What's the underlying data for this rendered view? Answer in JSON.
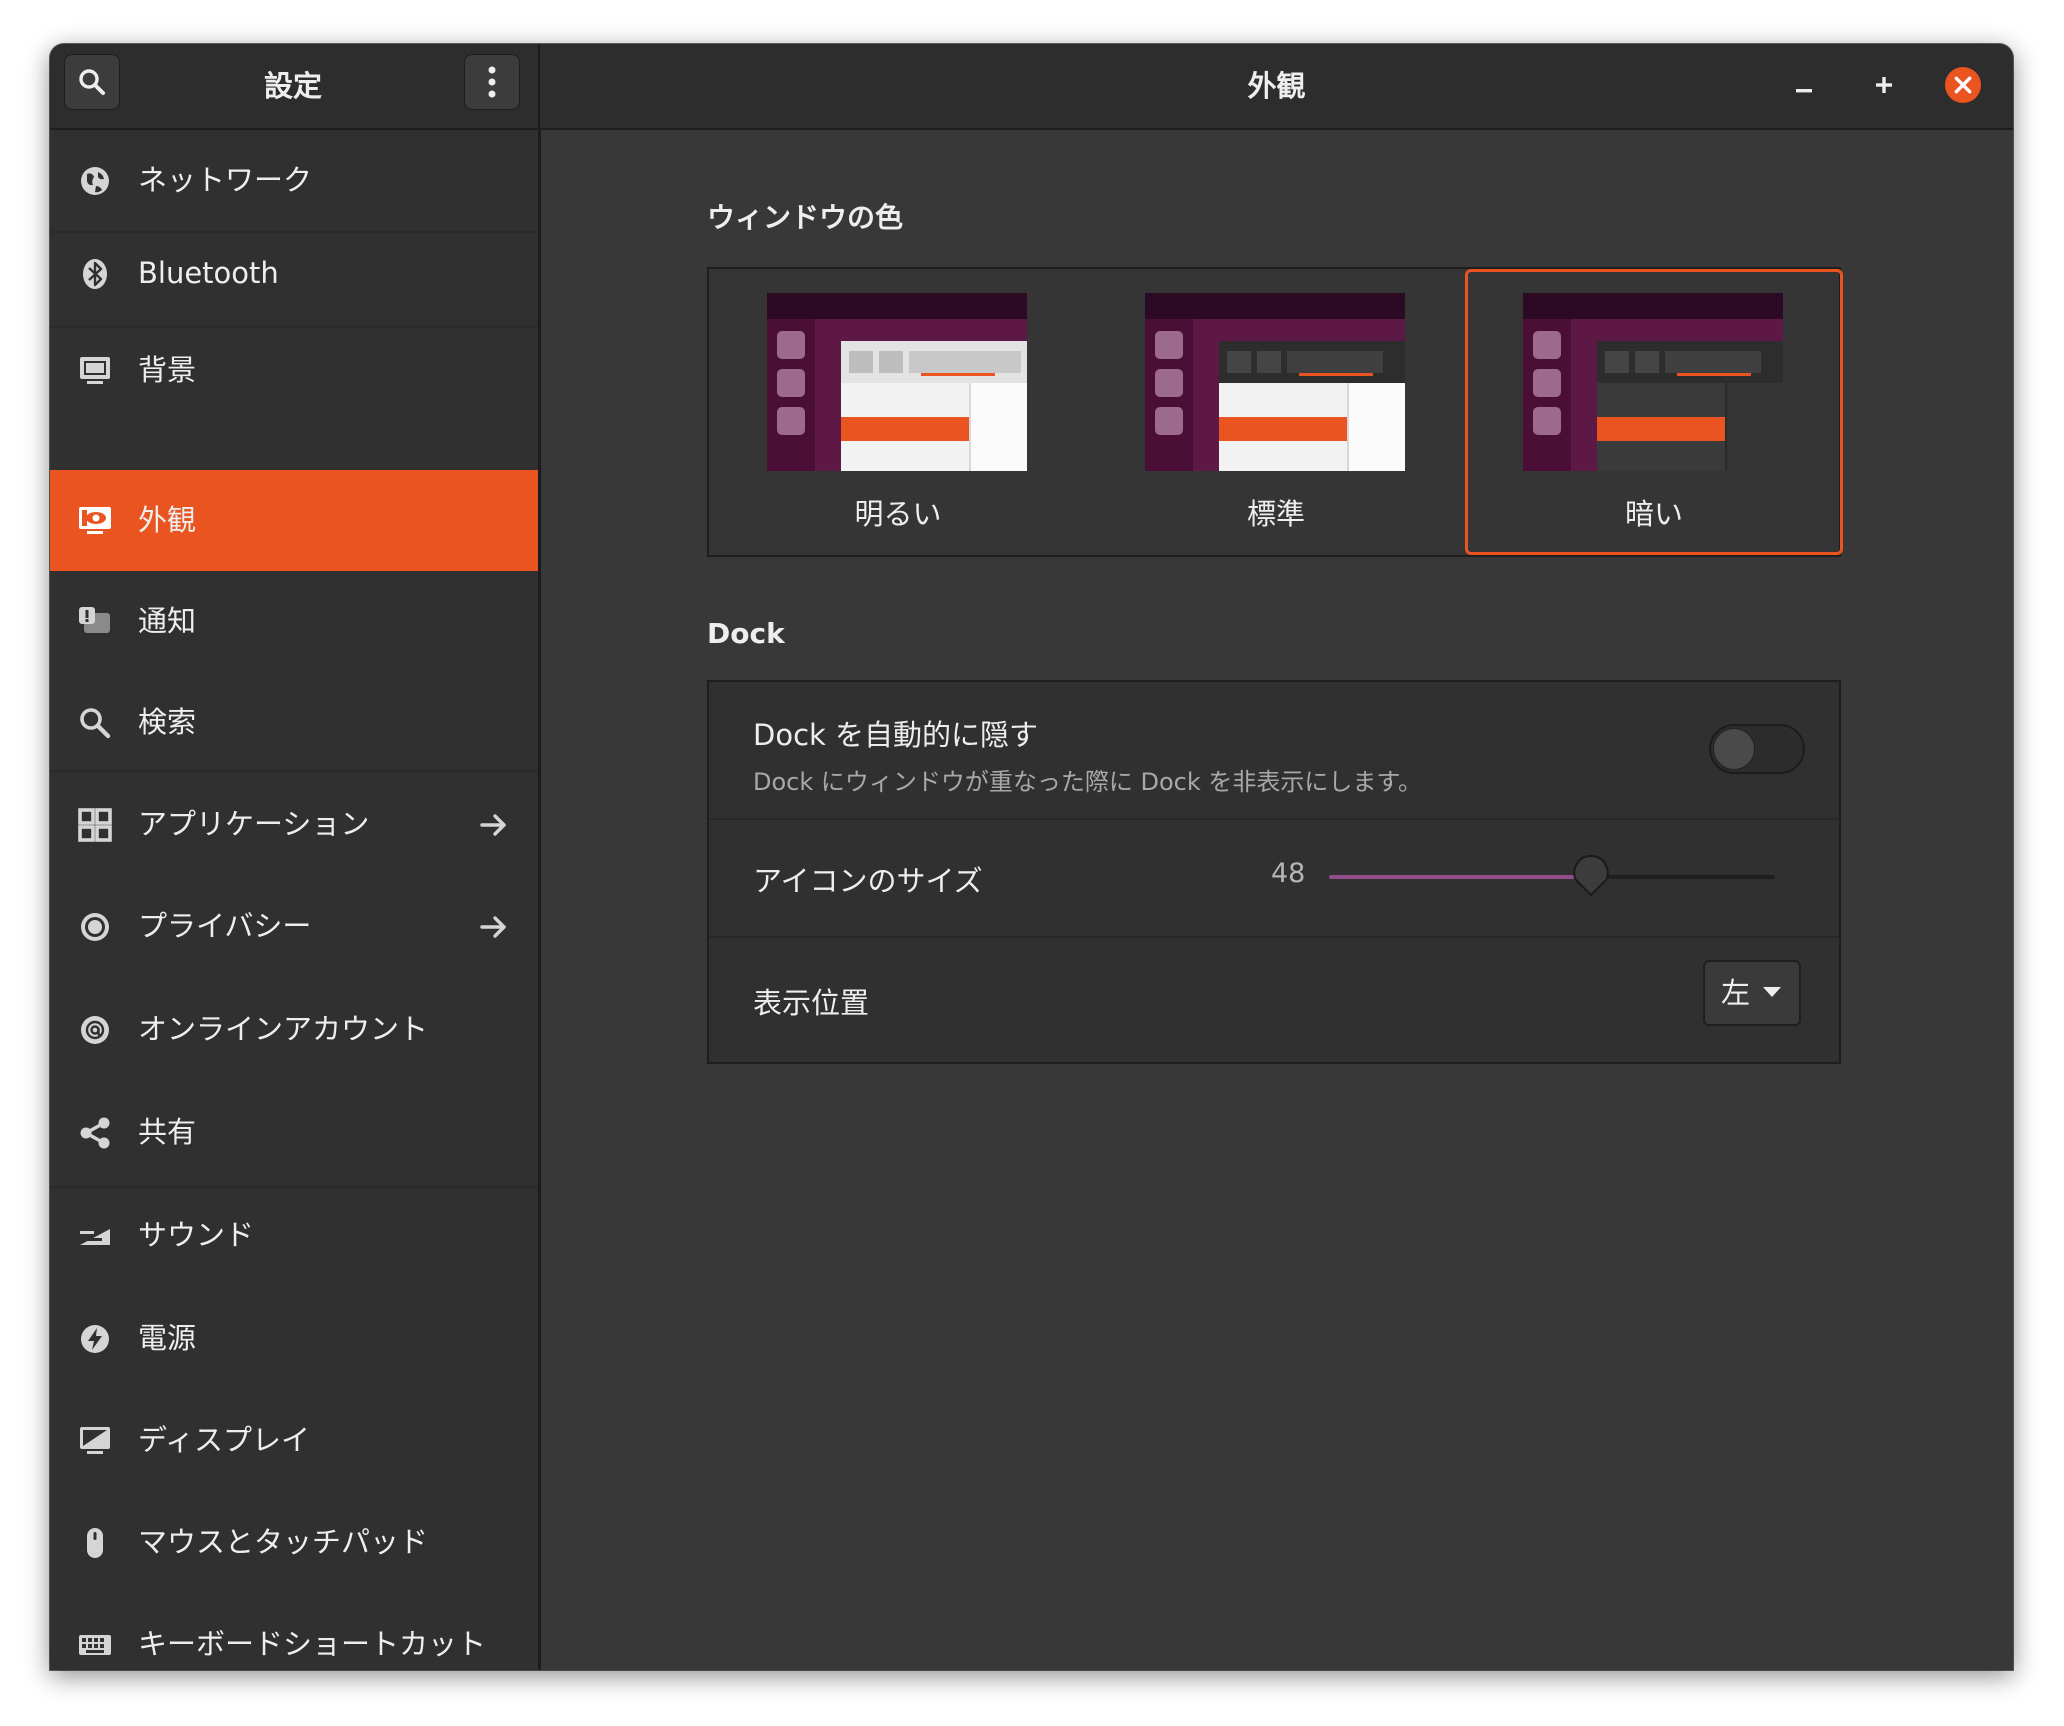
{
  "window": {
    "sidebar_title": "設定",
    "page_title": "外観",
    "accent_color": "#e95420",
    "close_color": "#e95420"
  },
  "sidebar": {
    "items": [
      {
        "label": "ネットワーク",
        "icon": "network-globe-icon",
        "active": false,
        "has_arrow": false
      },
      {
        "label": "Bluetooth",
        "icon": "bluetooth-icon",
        "active": false,
        "has_arrow": false
      },
      {
        "label": "背景",
        "icon": "monitor-background-icon",
        "active": false,
        "has_arrow": false
      },
      {
        "label": "外観",
        "icon": "appearance-eye-icon",
        "active": true,
        "has_arrow": false
      },
      {
        "label": "通知",
        "icon": "notification-icon",
        "active": false,
        "has_arrow": false
      },
      {
        "label": "検索",
        "icon": "search-icon",
        "active": false,
        "has_arrow": false
      },
      {
        "label": "アプリケーション",
        "icon": "apps-grid-icon",
        "active": false,
        "has_arrow": true
      },
      {
        "label": "プライバシー",
        "icon": "privacy-icon",
        "active": false,
        "has_arrow": true
      },
      {
        "label": "オンラインアカウント",
        "icon": "online-accounts-at-icon",
        "active": false,
        "has_arrow": false
      },
      {
        "label": "共有",
        "icon": "share-icon",
        "active": false,
        "has_arrow": false
      },
      {
        "label": "サウンド",
        "icon": "sound-icon",
        "active": false,
        "has_arrow": false
      },
      {
        "label": "電源",
        "icon": "power-icon",
        "active": false,
        "has_arrow": false
      },
      {
        "label": "ディスプレイ",
        "icon": "display-icon",
        "active": false,
        "has_arrow": false
      },
      {
        "label": "マウスとタッチパッド",
        "icon": "mouse-icon",
        "active": false,
        "has_arrow": false
      },
      {
        "label": "キーボードショートカット",
        "icon": "keyboard-icon",
        "active": false,
        "has_arrow": false
      }
    ]
  },
  "window_color": {
    "title": "ウィンドウの色",
    "options": [
      {
        "label": "明るい",
        "selected": false
      },
      {
        "label": "標準",
        "selected": false
      },
      {
        "label": "暗い",
        "selected": true
      }
    ]
  },
  "dock": {
    "title": "Dock",
    "autohide": {
      "label": "Dock を自動的に隠す",
      "description": "Dock にウィンドウが重なった際に Dock を非表示にします。",
      "enabled": false
    },
    "icon_size": {
      "label": "アイコンのサイズ",
      "value": "48",
      "min": 16,
      "max": 64
    },
    "position": {
      "label": "表示位置",
      "selected": "左"
    }
  }
}
